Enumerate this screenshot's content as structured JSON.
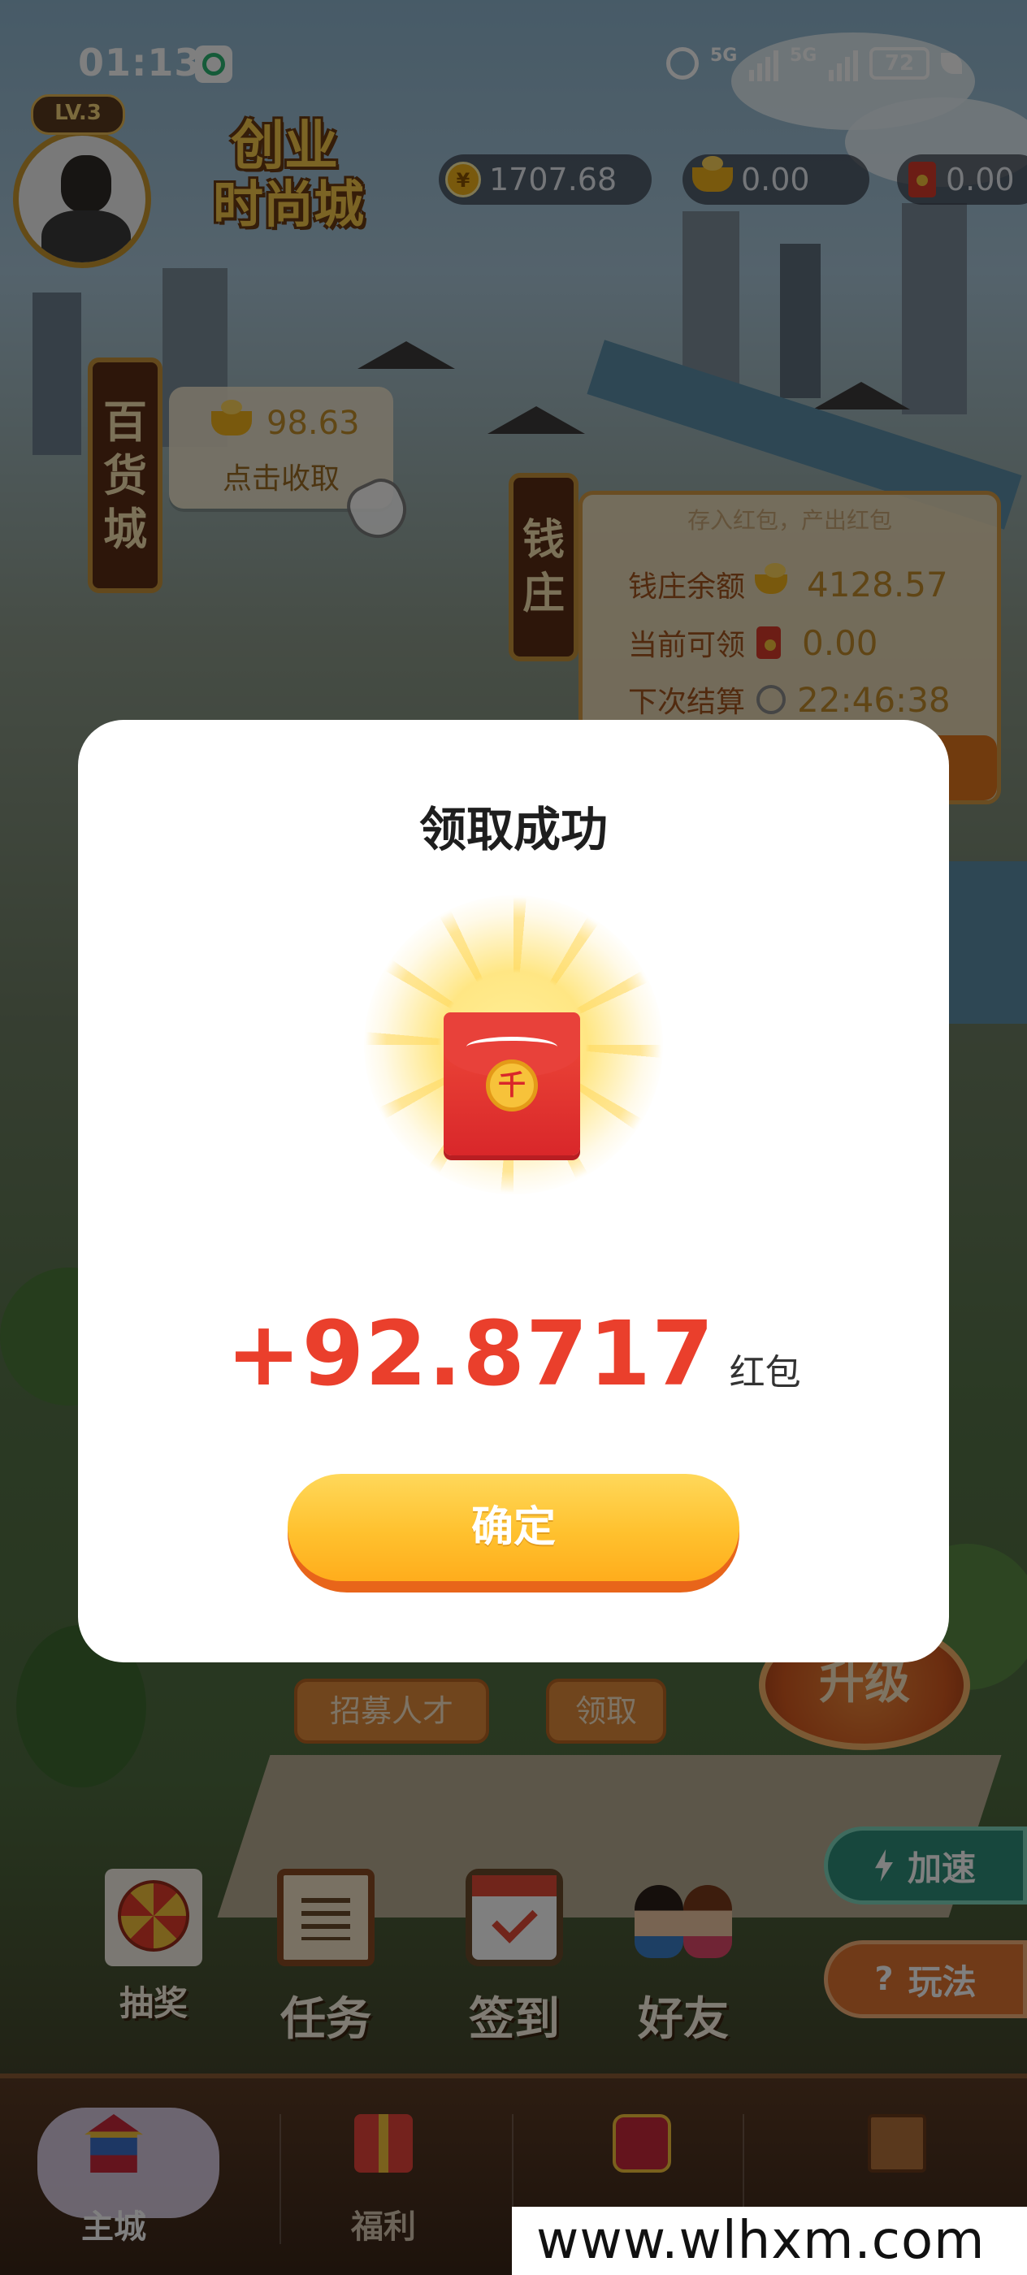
{
  "status_bar": {
    "time": "01:13",
    "network_1": "5G",
    "network_2": "5G",
    "battery": "72"
  },
  "hud": {
    "level": "LV.3",
    "logo_line1": "创业",
    "logo_line2": "时尚城",
    "gold_coins": "1707.68",
    "gold_ingots": "0.00",
    "red_packets": "0.00"
  },
  "department_store": {
    "sign": [
      "百",
      "货",
      "城"
    ],
    "pending_amount": "98.63",
    "collect_label": "点击收取"
  },
  "bank": {
    "sign": [
      "钱",
      "庄"
    ],
    "tagline": "存入红包，产出红包",
    "balance_label": "钱庄余额",
    "balance_value": "4128.57",
    "claimable_label": "当前可领",
    "claimable_value": "0.00",
    "next_settle_label": "下次结算",
    "next_settle_value": "22:46:38"
  },
  "scene_buttons": {
    "recruit": "招募人才",
    "claim": "领取",
    "upgrade": "升级",
    "speed_up": "加速",
    "how_to_play": "玩法"
  },
  "features": [
    {
      "label": "抽奖",
      "icon": "lucky-wheel-icon"
    },
    {
      "label": "任务",
      "icon": "task-scroll-icon"
    },
    {
      "label": "签到",
      "icon": "checkin-calendar-icon"
    },
    {
      "label": "好友",
      "icon": "friends-icon"
    }
  ],
  "bottom_nav": [
    {
      "label": "主城",
      "icon": "palace-icon",
      "active": true
    },
    {
      "label": "福利",
      "icon": "gift-icon",
      "active": false
    },
    {
      "label": "",
      "icon": "lantern-icon",
      "active": false
    },
    {
      "label": "",
      "icon": "book-icon",
      "active": false
    }
  ],
  "modal": {
    "title": "领取成功",
    "amount": "+92.8717",
    "unit": "红包",
    "confirm_label": "确定",
    "coin_glyph": "千"
  },
  "watermark": "www.wlhxm.com",
  "colors": {
    "reward_red": "#ea3f2c",
    "button_yellow": "#ffc12e",
    "button_shadow": "#e8651a",
    "brand_brown": "#5a2c14"
  }
}
